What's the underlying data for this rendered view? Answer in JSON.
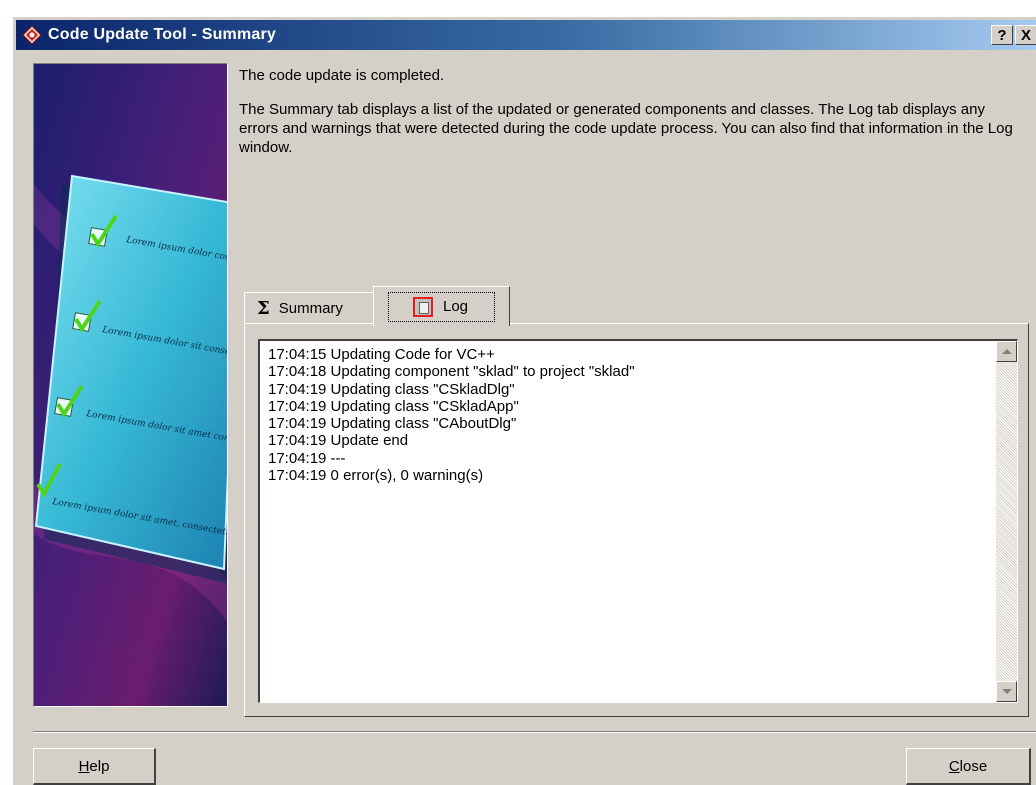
{
  "window": {
    "title": "Code Update Tool - Summary",
    "help_glyph": "?",
    "close_glyph": "X"
  },
  "intro": {
    "line1": "The code update is completed.",
    "paragraph": "The Summary tab displays a list of the updated or generated components and classes. The Log tab displays any errors and warnings that were detected during the code update process. You can also find that information in the Log window."
  },
  "side_image": {
    "items": [
      "Lorem ipsum dolor consectetuer adipis",
      "Lorem ipsum dolor sit consectetuer adipiscing",
      "Lorem ipsum dolor sit amet consectetuer adipiscing elit.",
      "Lorem ipsum dolor sit amet, consectetuer adipiscing elit."
    ]
  },
  "tabs": [
    {
      "label": "Summary",
      "icon": "sigma-icon",
      "glyph": "Σ",
      "selected": false
    },
    {
      "label": "Log",
      "icon": "log-icon",
      "selected": true
    }
  ],
  "log": {
    "lines": [
      "17:04:15 Updating Code for VC++",
      "17:04:18 Updating component \"sklad\" to project \"sklad\"",
      "17:04:19 Updating class \"CSkladDlg\"",
      "17:04:19 Updating class \"CSkladApp\"",
      "17:04:19 Updating class \"CAboutDlg\"",
      "17:04:19 Update end",
      "17:04:19 ---",
      "17:04:19 0 error(s), 0 warning(s)"
    ]
  },
  "buttons": {
    "help": {
      "mnemonic": "H",
      "rest": "elp"
    },
    "close": {
      "mnemonic": "C",
      "rest": "lose"
    }
  },
  "colors": {
    "titlebar_start": "#0a246a",
    "titlebar_end": "#a6caf0",
    "face": "#d4d0c8"
  }
}
